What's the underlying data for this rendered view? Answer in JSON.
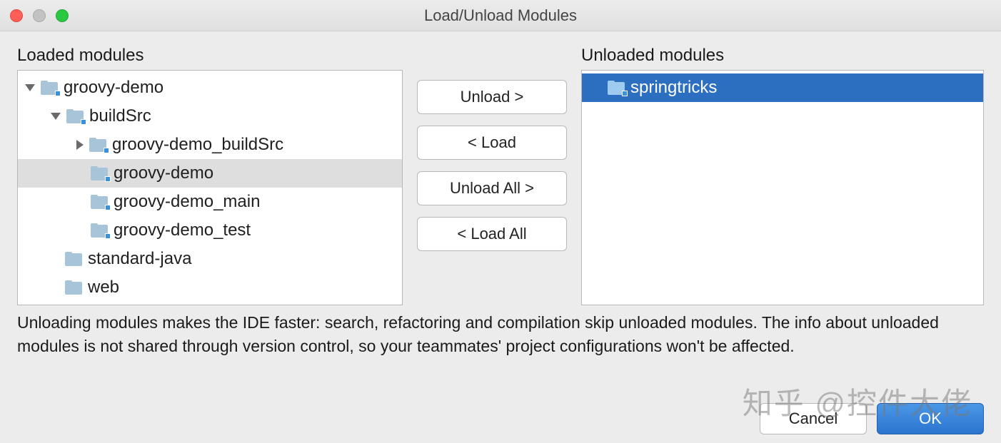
{
  "window": {
    "title": "Load/Unload Modules"
  },
  "labels": {
    "loaded": "Loaded modules",
    "unloaded": "Unloaded modules"
  },
  "loaded_tree": {
    "root": {
      "name": "groovy-demo"
    },
    "buildSrc": {
      "name": "buildSrc"
    },
    "buildSrc_child": {
      "name": "groovy-demo_buildSrc"
    },
    "groovy_demo": {
      "name": "groovy-demo"
    },
    "groovy_demo_main": {
      "name": "groovy-demo_main"
    },
    "groovy_demo_test": {
      "name": "groovy-demo_test"
    },
    "standard_java": {
      "name": "standard-java"
    },
    "web": {
      "name": "web"
    }
  },
  "unloaded_tree": {
    "springtricks": {
      "name": "springtricks"
    }
  },
  "buttons": {
    "unload": "Unload >",
    "load": "< Load",
    "unload_all": "Unload All >",
    "load_all": "< Load All",
    "cancel": "Cancel",
    "ok": "OK"
  },
  "help": "Unloading modules makes the IDE faster: search, refactoring and compilation skip unloaded modules. The info about unloaded modules is not shared through version control, so your teammates' project configurations won't be affected.",
  "watermark": "知乎 @控件大佬"
}
